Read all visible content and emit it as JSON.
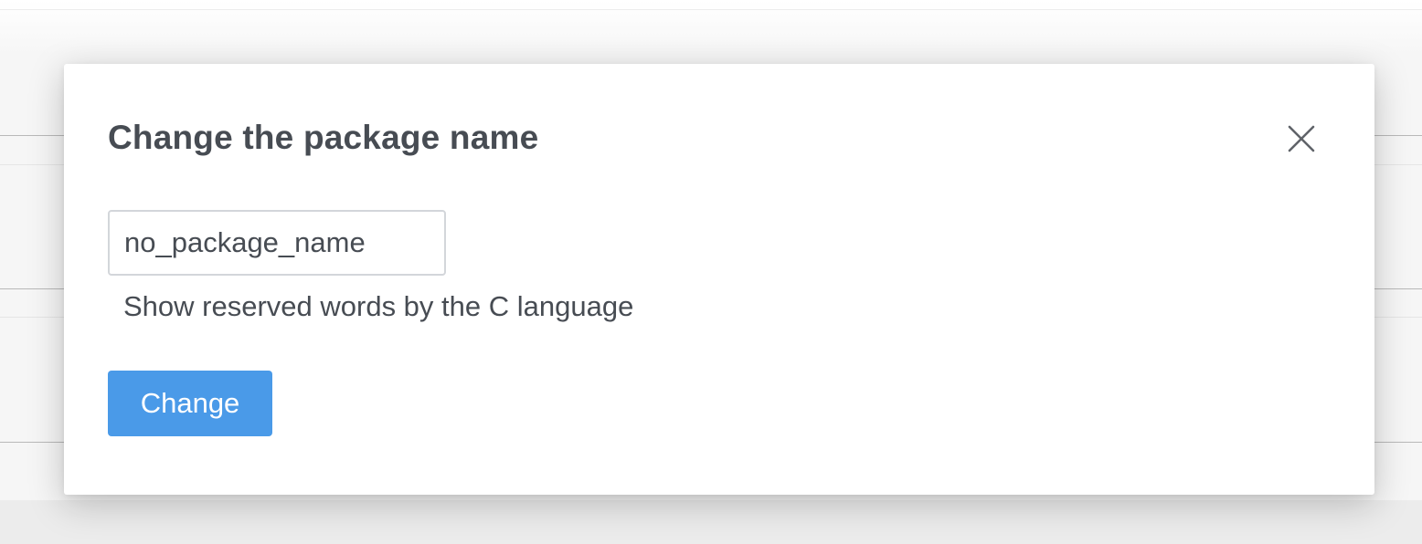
{
  "dialog": {
    "title": "Change the package name",
    "close_icon": "close-icon",
    "input": {
      "value": "no_package_name",
      "placeholder": ""
    },
    "reserved_words_link": "Show reserved words by the C language",
    "submit_label": "Change"
  },
  "colors": {
    "title_text": "#474c53",
    "primary_button": "#4a9ae8",
    "input_border": "#d3d6da"
  }
}
